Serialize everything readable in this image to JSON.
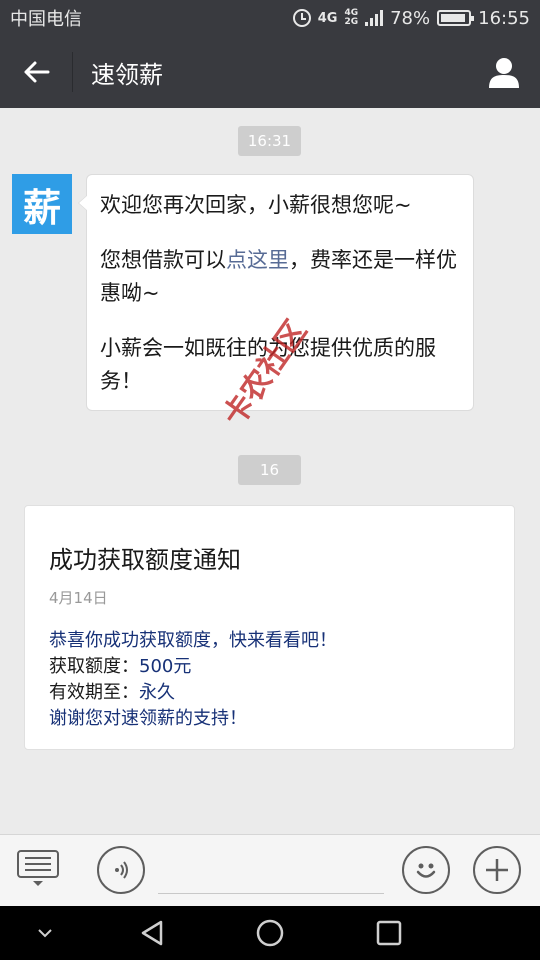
{
  "status_bar": {
    "carrier": "中国电信",
    "network_4g": "4G",
    "network_4g_small": "4G",
    "network_2g": "2G",
    "battery": "78%",
    "time": "16:55"
  },
  "header": {
    "title": "速领薪"
  },
  "chat": {
    "timestamp_1": "16:31",
    "timestamp_2": "16",
    "avatar_text": "薪",
    "message": {
      "line1": "欢迎您再次回家，小薪很想您呢~",
      "line2_prefix": "您想借款可以",
      "line2_link": "点这里",
      "line2_suffix": "，费率还是一样优惠呦~",
      "line3": "小薪会一如既往的为您提供优质的服务！"
    },
    "card": {
      "title": "成功获取额度通知",
      "date": "4月14日",
      "line1": "恭喜你成功获取额度，快来看看吧！",
      "line2_label": "获取额度：",
      "line2_value": "500元",
      "line3_label": "有效期至：",
      "line3_value": "永久",
      "line4": "谢谢您对速领薪的支持！"
    },
    "watermark": "卡农社区"
  },
  "colors": {
    "header_bg": "#393a3f",
    "avatar_bg": "#2f9de6",
    "link": "#576b95",
    "card_text_blue": "#173177"
  }
}
